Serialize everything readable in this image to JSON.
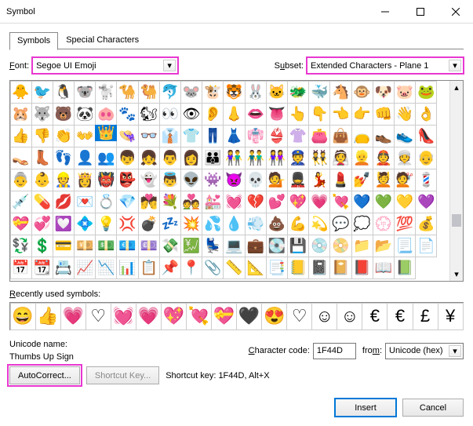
{
  "title": "Symbol",
  "tabs": [
    "Symbols",
    "Special Characters"
  ],
  "font_label": "Font:",
  "font": "Segoe UI Emoji",
  "subset_label": "Subset:",
  "subset": "Extended Characters - Plane 1",
  "grid": [
    "🐥",
    "🐦",
    "🐧",
    "🐨",
    "🐩",
    "🐪",
    "🐫",
    "🐬",
    "🐭",
    "🐮",
    "🐯",
    "🐰",
    "🐱",
    "🐲",
    "🐳",
    "🐴",
    "🐵",
    "🐶",
    "🐷",
    "🐸",
    "🐹",
    "🐺",
    "🐻",
    "🐼",
    "🐽",
    "🐾",
    "🐿",
    "👀",
    "👁",
    "👂",
    "👃",
    "👄",
    "👅",
    "👆",
    "👇",
    "👈",
    "👉",
    "👊",
    "👋",
    "👌",
    "👍",
    "👎",
    "👏",
    "👐",
    "👑",
    "👒",
    "👓",
    "👔",
    "👕",
    "👖",
    "👗",
    "👘",
    "👙",
    "👚",
    "👛",
    "👜",
    "👝",
    "👞",
    "👟",
    "👠",
    "👡",
    "👢",
    "👣",
    "👤",
    "👥",
    "👦",
    "👧",
    "👨",
    "👩",
    "👪",
    "👫",
    "👬",
    "👭",
    "👮",
    "👯",
    "👰",
    "👱",
    "👲",
    "👳",
    "👴",
    "👵",
    "👶",
    "👷",
    "👸",
    "👹",
    "👺",
    "👻",
    "👼",
    "👽",
    "👾",
    "👿",
    "💀",
    "💁",
    "💂",
    "💃",
    "💄",
    "💅",
    "💆",
    "💇",
    "💈",
    "💉",
    "💊",
    "💋",
    "💌",
    "💍",
    "💎",
    "💏",
    "💐",
    "💑",
    "💒",
    "💓",
    "💔",
    "💕",
    "💖",
    "💗",
    "💘",
    "💙",
    "💚",
    "💛",
    "💜",
    "💝",
    "💞",
    "💟",
    "💠",
    "💡",
    "💢",
    "💣",
    "💤",
    "💥",
    "💦",
    "💧",
    "💨",
    "💩",
    "💪",
    "💫",
    "💬",
    "💭",
    "💮",
    "💯",
    "💰",
    "💱",
    "💲",
    "💳",
    "💴",
    "💵",
    "💶",
    "💷",
    "💸",
    "💹",
    "💺",
    "💻",
    "💼",
    "💽",
    "💾",
    "💿",
    "📀",
    "📁",
    "📂",
    "📃",
    "📄",
    "📅",
    "📆",
    "📇",
    "📈",
    "📉",
    "📊",
    "📋",
    "📌",
    "📍",
    "📎",
    "📏",
    "📐",
    "📑",
    "📒",
    "📓",
    "📔",
    "📕",
    "📖",
    "📗"
  ],
  "selected_index": 44,
  "recent_label": "Recently used symbols:",
  "recent": [
    "😄",
    "👍",
    "💗",
    "♡",
    "💓",
    "💗",
    "💖",
    "💘",
    "💝",
    "🖤",
    "😍",
    "♡",
    "☺",
    "☺",
    "€",
    "€",
    "£",
    "¥"
  ],
  "unicode_name_label": "Unicode name:",
  "unicode_name": "Thumbs Up Sign",
  "char_code_label": "Character code:",
  "char_code": "1F44D",
  "from_label": "from:",
  "from": "Unicode (hex)",
  "autocorrect": "AutoCorrect...",
  "shortcut_key": "Shortcut Key...",
  "shortcut_lbl": "Shortcut key: 1F44D, Alt+X",
  "insert": "Insert",
  "cancel": "Cancel"
}
